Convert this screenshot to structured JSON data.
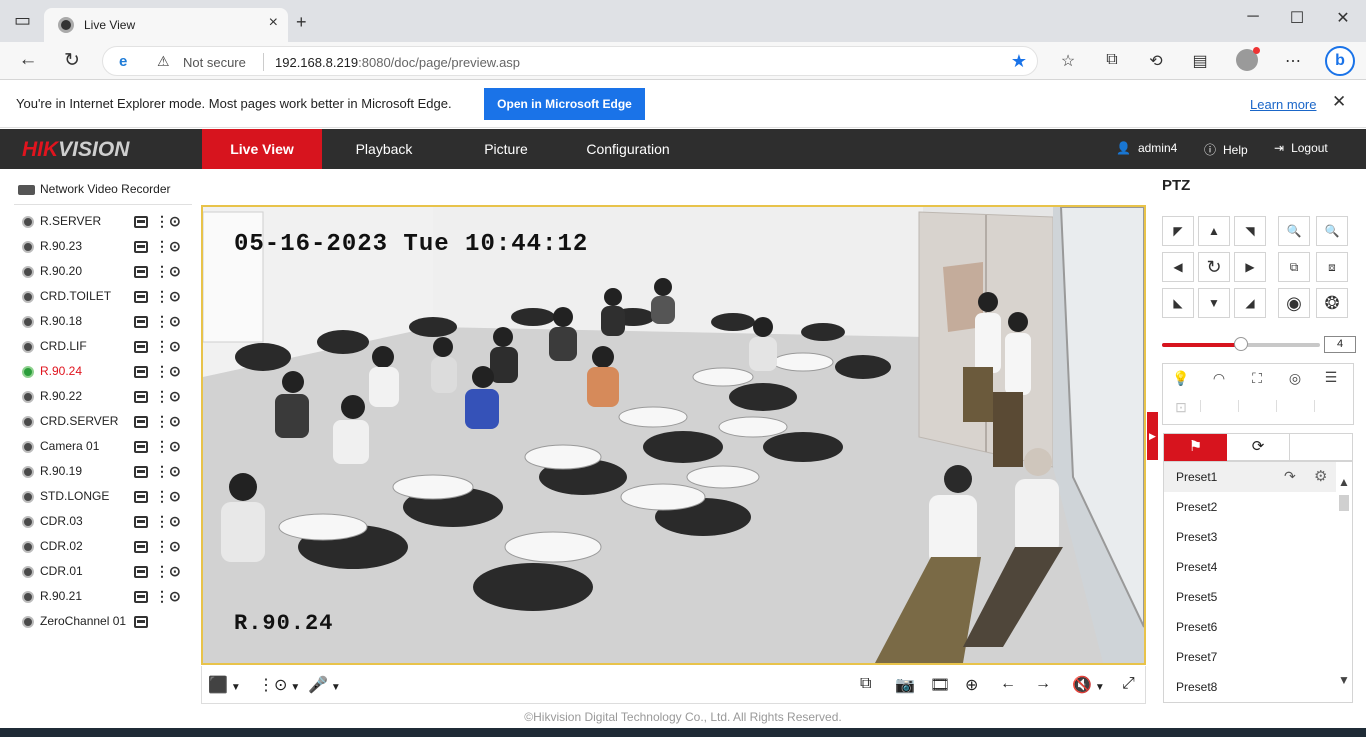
{
  "browser": {
    "tab_title": "Live View",
    "tab_close": "×",
    "new_tab": "+",
    "security_label": "Not secure",
    "url_host": "192.168.8.219",
    "url_port_path": ":8080/doc/page/preview.asp"
  },
  "ie_banner": {
    "message": "You're in Internet Explorer mode. Most pages work better in Microsoft Edge.",
    "open_button": "Open in Microsoft Edge",
    "learn_more": "Learn more"
  },
  "app": {
    "logo_part1": "HIK",
    "logo_part2": "VISION",
    "nav": [
      "Live View",
      "Playback",
      "Picture",
      "Configuration"
    ],
    "user": "admin4",
    "help": "Help",
    "logout": "Logout"
  },
  "tree": {
    "root": "Network Video Recorder",
    "cameras": [
      {
        "name": "R.SERVER",
        "status": "offline"
      },
      {
        "name": "R.90.23",
        "status": "offline"
      },
      {
        "name": "R.90.20",
        "status": "offline"
      },
      {
        "name": "CRD.TOILET",
        "status": "offline"
      },
      {
        "name": "R.90.18",
        "status": "offline"
      },
      {
        "name": "CRD.LIF",
        "status": "offline"
      },
      {
        "name": "R.90.24",
        "status": "playing"
      },
      {
        "name": "R.90.22",
        "status": "offline"
      },
      {
        "name": "CRD.SERVER",
        "status": "offline"
      },
      {
        "name": "Camera 01",
        "status": "offline"
      },
      {
        "name": "R.90.19",
        "status": "offline"
      },
      {
        "name": "STD.LONGE",
        "status": "offline"
      },
      {
        "name": "CDR.03",
        "status": "offline"
      },
      {
        "name": "CDR.02",
        "status": "offline"
      },
      {
        "name": "CDR.01",
        "status": "offline"
      },
      {
        "name": "R.90.21",
        "status": "offline"
      },
      {
        "name": "ZeroChannel 01",
        "status": "offline"
      }
    ]
  },
  "video": {
    "osd_time": "05-16-2023 Tue 10:44:12",
    "osd_name": "R.90.24"
  },
  "ptz": {
    "title": "PTZ",
    "speed": "4",
    "speed_fraction": 0.5,
    "presets": [
      "Preset1",
      "Preset2",
      "Preset3",
      "Preset4",
      "Preset5",
      "Preset6",
      "Preset7",
      "Preset8"
    ]
  },
  "footer": "©Hikvision Digital Technology Co., Ltd. All Rights Reserved.",
  "colors": {
    "brand_red": "#d7141e",
    "header_bg": "#2e2e2e",
    "edge_blue": "#1a73e8",
    "video_border": "#e8c34a"
  }
}
